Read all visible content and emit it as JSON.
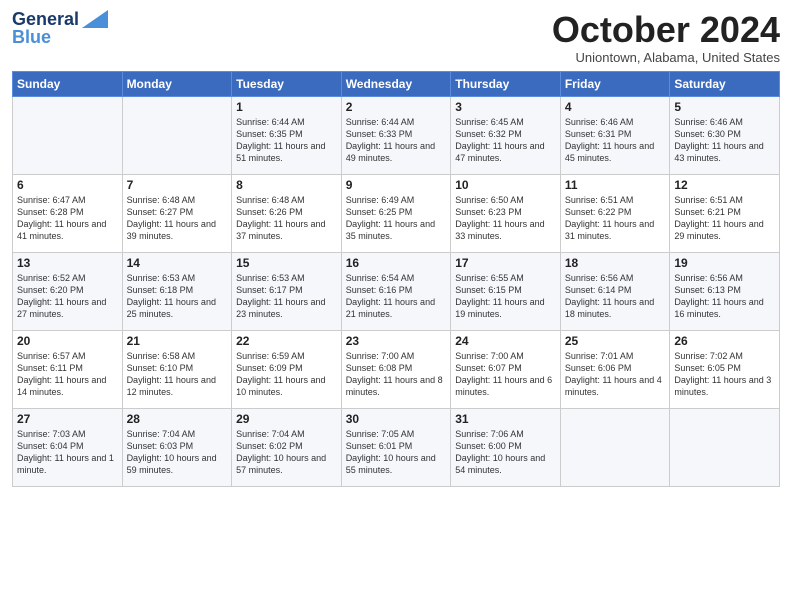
{
  "header": {
    "logo_line1": "General",
    "logo_line2": "Blue",
    "month_title": "October 2024",
    "subtitle": "Uniontown, Alabama, United States"
  },
  "days_of_week": [
    "Sunday",
    "Monday",
    "Tuesday",
    "Wednesday",
    "Thursday",
    "Friday",
    "Saturday"
  ],
  "weeks": [
    [
      {
        "day": "",
        "info": ""
      },
      {
        "day": "",
        "info": ""
      },
      {
        "day": "1",
        "info": "Sunrise: 6:44 AM\nSunset: 6:35 PM\nDaylight: 11 hours and 51 minutes."
      },
      {
        "day": "2",
        "info": "Sunrise: 6:44 AM\nSunset: 6:33 PM\nDaylight: 11 hours and 49 minutes."
      },
      {
        "day": "3",
        "info": "Sunrise: 6:45 AM\nSunset: 6:32 PM\nDaylight: 11 hours and 47 minutes."
      },
      {
        "day": "4",
        "info": "Sunrise: 6:46 AM\nSunset: 6:31 PM\nDaylight: 11 hours and 45 minutes."
      },
      {
        "day": "5",
        "info": "Sunrise: 6:46 AM\nSunset: 6:30 PM\nDaylight: 11 hours and 43 minutes."
      }
    ],
    [
      {
        "day": "6",
        "info": "Sunrise: 6:47 AM\nSunset: 6:28 PM\nDaylight: 11 hours and 41 minutes."
      },
      {
        "day": "7",
        "info": "Sunrise: 6:48 AM\nSunset: 6:27 PM\nDaylight: 11 hours and 39 minutes."
      },
      {
        "day": "8",
        "info": "Sunrise: 6:48 AM\nSunset: 6:26 PM\nDaylight: 11 hours and 37 minutes."
      },
      {
        "day": "9",
        "info": "Sunrise: 6:49 AM\nSunset: 6:25 PM\nDaylight: 11 hours and 35 minutes."
      },
      {
        "day": "10",
        "info": "Sunrise: 6:50 AM\nSunset: 6:23 PM\nDaylight: 11 hours and 33 minutes."
      },
      {
        "day": "11",
        "info": "Sunrise: 6:51 AM\nSunset: 6:22 PM\nDaylight: 11 hours and 31 minutes."
      },
      {
        "day": "12",
        "info": "Sunrise: 6:51 AM\nSunset: 6:21 PM\nDaylight: 11 hours and 29 minutes."
      }
    ],
    [
      {
        "day": "13",
        "info": "Sunrise: 6:52 AM\nSunset: 6:20 PM\nDaylight: 11 hours and 27 minutes."
      },
      {
        "day": "14",
        "info": "Sunrise: 6:53 AM\nSunset: 6:18 PM\nDaylight: 11 hours and 25 minutes."
      },
      {
        "day": "15",
        "info": "Sunrise: 6:53 AM\nSunset: 6:17 PM\nDaylight: 11 hours and 23 minutes."
      },
      {
        "day": "16",
        "info": "Sunrise: 6:54 AM\nSunset: 6:16 PM\nDaylight: 11 hours and 21 minutes."
      },
      {
        "day": "17",
        "info": "Sunrise: 6:55 AM\nSunset: 6:15 PM\nDaylight: 11 hours and 19 minutes."
      },
      {
        "day": "18",
        "info": "Sunrise: 6:56 AM\nSunset: 6:14 PM\nDaylight: 11 hours and 18 minutes."
      },
      {
        "day": "19",
        "info": "Sunrise: 6:56 AM\nSunset: 6:13 PM\nDaylight: 11 hours and 16 minutes."
      }
    ],
    [
      {
        "day": "20",
        "info": "Sunrise: 6:57 AM\nSunset: 6:11 PM\nDaylight: 11 hours and 14 minutes."
      },
      {
        "day": "21",
        "info": "Sunrise: 6:58 AM\nSunset: 6:10 PM\nDaylight: 11 hours and 12 minutes."
      },
      {
        "day": "22",
        "info": "Sunrise: 6:59 AM\nSunset: 6:09 PM\nDaylight: 11 hours and 10 minutes."
      },
      {
        "day": "23",
        "info": "Sunrise: 7:00 AM\nSunset: 6:08 PM\nDaylight: 11 hours and 8 minutes."
      },
      {
        "day": "24",
        "info": "Sunrise: 7:00 AM\nSunset: 6:07 PM\nDaylight: 11 hours and 6 minutes."
      },
      {
        "day": "25",
        "info": "Sunrise: 7:01 AM\nSunset: 6:06 PM\nDaylight: 11 hours and 4 minutes."
      },
      {
        "day": "26",
        "info": "Sunrise: 7:02 AM\nSunset: 6:05 PM\nDaylight: 11 hours and 3 minutes."
      }
    ],
    [
      {
        "day": "27",
        "info": "Sunrise: 7:03 AM\nSunset: 6:04 PM\nDaylight: 11 hours and 1 minute."
      },
      {
        "day": "28",
        "info": "Sunrise: 7:04 AM\nSunset: 6:03 PM\nDaylight: 10 hours and 59 minutes."
      },
      {
        "day": "29",
        "info": "Sunrise: 7:04 AM\nSunset: 6:02 PM\nDaylight: 10 hours and 57 minutes."
      },
      {
        "day": "30",
        "info": "Sunrise: 7:05 AM\nSunset: 6:01 PM\nDaylight: 10 hours and 55 minutes."
      },
      {
        "day": "31",
        "info": "Sunrise: 7:06 AM\nSunset: 6:00 PM\nDaylight: 10 hours and 54 minutes."
      },
      {
        "day": "",
        "info": ""
      },
      {
        "day": "",
        "info": ""
      }
    ]
  ]
}
